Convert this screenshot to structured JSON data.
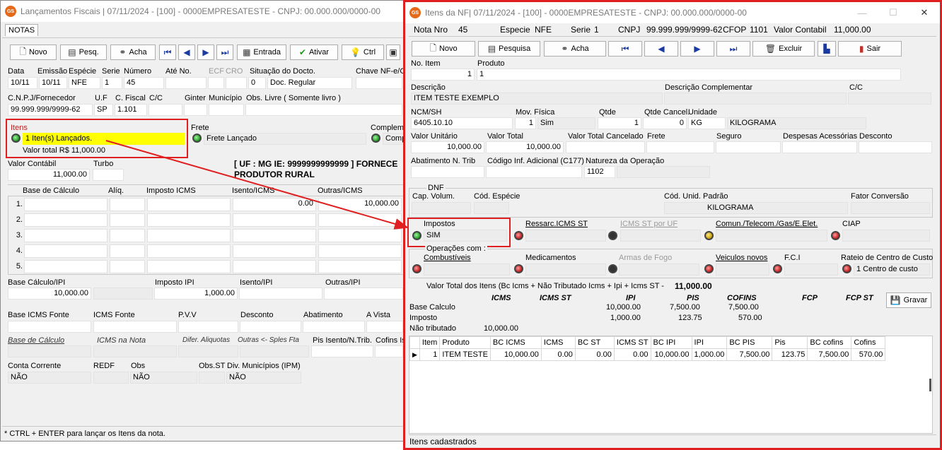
{
  "left": {
    "title": "Lançamentos Fiscais | 07/11/2024 - [100] - 0000EMPRESATESTE - CNPJ: 00.000.000/0000-00",
    "tab": "NOTAS",
    "toolbar": {
      "novo": "Novo",
      "pesq": "Pesq.",
      "acha": "Acha",
      "entrada": "Entrada",
      "ativar": "Ativar",
      "ctrl": "Ctrl"
    },
    "labels": {
      "data": "Data",
      "emissao": "Emissão",
      "especie": "Espécie",
      "serie": "Serie",
      "numero": "Número",
      "ate_no": "Até No.",
      "ecf": "ECF",
      "cro": "CRO",
      "situacao": "Situação do Docto.",
      "chave": "Chave NF-e/CT",
      "cnpj": "C.N.P.J/Fornecedor",
      "uf": "U.F",
      "cfiscal": "C. Fiscal",
      "cc": "C/C",
      "ginter": "Ginter",
      "municipio": "Município",
      "obs_livre": "Obs. Livre ( Somente livro )",
      "itens": "Itens",
      "frete": "Frete",
      "complem": "Complemen",
      "valor_contabil": "Valor Contábil",
      "turbo": "Turbo",
      "base_calc": "Base de Cálculo",
      "aliq": "Alíq.",
      "imposto_icms": "Imposto ICMS",
      "isento_icms": "Isento/ICMS",
      "outras_icms": "Outras/ICMS",
      "base_ipi": "Base Cálculo/IPI",
      "imposto_ipi": "Imposto IPI",
      "isento_ipi": "Isento/IPI",
      "outras_ipi": "Outras/IPI",
      "base_icms_fonte": "Base ICMS Fonte",
      "icms_fonte": "ICMS Fonte",
      "pvv": "P.V.V",
      "desconto": "Desconto",
      "abatimento": "Abatimento",
      "a_vista": "A Vista",
      "base_calc2": "Base de Cálculo",
      "icms_na_nota": "ICMS na Nota",
      "difer": "Difer. Aliquotas",
      "outras_sples": "Outras <- Sples Fta",
      "pis_isento": "Pis Isento/N.Trib.",
      "cofins_ise": "Cofins Ise",
      "conta_corrente": "Conta Corrente",
      "redf": "REDF",
      "obs": "Obs",
      "obs_st": "Obs.ST",
      "div_mun": "Div. Municípios (IPM)"
    },
    "values": {
      "data": "10/11",
      "emissao": "10/11",
      "especie": "NFE",
      "serie": "1",
      "numero": "45",
      "sit_code": "0",
      "sit_text": "Doc. Regular",
      "cnpj": "99.999.999/9999-62",
      "uf": "SP",
      "cfiscal": "1.101",
      "itens_status": "1 Iten(s) Lançados.",
      "itens_total": "Valor total R$ 11,000.00",
      "frete_status": "Frete Lançado",
      "complem_status": "Compl",
      "valor_contabil": "11,000.00",
      "uf_banner_line1": "[ UF : MG IE: 9999999999999 ] FORNECE",
      "uf_banner_line2": "PRODUTOR RURAL",
      "row1_isento": "0.00",
      "row1_outras": "10,000.00",
      "base_ipi": "10,000.00",
      "imposto_ipi": "1,000.00",
      "conta_corrente": "NÃO",
      "obs": "NÃO",
      "div_mun": "NÃO"
    },
    "rows": [
      "1.",
      "2.",
      "3.",
      "4.",
      "5."
    ],
    "status": "* CTRL + ENTER para  lançar os Itens da nota."
  },
  "right": {
    "title": "Itens da NF| 07/11/2024 - [100] - 0000EMPRESATESTE - CNPJ: 00.000.000/0000-00",
    "header": {
      "nota_nro_label": "Nota Nro",
      "nota_nro": "45",
      "especie_label": "Especie",
      "especie": "NFE",
      "serie_label": "Serie",
      "serie": "1",
      "cnpj_label": "CNPJ",
      "cnpj": "99.999.999/9999-62",
      "cfop_label": "CFOP",
      "cfop": "1101",
      "valor_label": "Valor Contabil",
      "valor": "11,000.00"
    },
    "toolbar": {
      "novo": "Novo",
      "pesquisa": "Pesquisa",
      "acha": "Acha",
      "excluir": "Excluir",
      "sair": "Sair"
    },
    "labels": {
      "no_item": "No. Item",
      "produto": "Produto",
      "descricao": "Descrição",
      "desc_comp": "Descrição Complementar",
      "cc": "C/C",
      "ncm": "NCM/SH",
      "mov_fisica": "Mov. Física",
      "qtde": "Qtde",
      "qtde_cancel": "Qtde Cancel.",
      "unidade": "Unidade",
      "valor_unit": "Valor Unitário",
      "valor_total": "Valor Total",
      "valor_total_cancel": "Valor Total Cancelado",
      "frete": "Frete",
      "seguro": "Seguro",
      "desp_acess": "Despesas Acessórias",
      "desconto": "Desconto",
      "abatimento": "Abatimento N. Trib",
      "cod_inf": "Código Inf. Adicional (C177)",
      "natureza": "Natureza da Operação",
      "dnf": "DNF",
      "cap_volum": "Cap. Volum.",
      "cod_especie": "Cód. Espécie",
      "cod_unid": "Cód. Unid. Padrão",
      "fator": "Fator Conversão",
      "impostos": "Impostos",
      "ressarc": "Ressarc.ICMS ST",
      "icms_st_uf": "ICMS ST por UF",
      "comun": "Comun./Telecom./Gas/E.Elet.",
      "ciap": "CIAP",
      "operacoes": "Operações com :",
      "combustiveis": "Combustíveis",
      "medicamentos": "Medicamentos",
      "armas": "Armas de Fogo",
      "veiculos": "Veiculos novos",
      "fci": "F.C.I",
      "rateio": "Rateio de Centro de Custo",
      "valor_total_itens": "Valor Total dos Itens (Bc Icms + Não Tributado Icms + Ipi + Icms ST -",
      "gravar": "Gravar"
    },
    "values": {
      "no_item": "1",
      "produto": "1",
      "descricao": "ITEM TESTE EXEMPLO",
      "ncm": "6405.10.10",
      "mov_fisica_code": "1",
      "mov_fisica": "Sim",
      "qtde": "1",
      "qtde_cancel": "0",
      "unid_code": "KG",
      "unid": "KILOGRAMA",
      "valor_unit": "10,000.00",
      "valor_total": "10,000.00",
      "natureza": "1102",
      "cod_unid": "KILOGRAMA",
      "impostos": "SIM",
      "rateio": "1 Centro de custo",
      "valor_total_itens": "11,000.00"
    },
    "summary": {
      "cols": [
        "ICMS",
        "ICMS ST",
        "IPI",
        "PIS",
        "COFINS",
        "FCP",
        "FCP ST"
      ],
      "rows": [
        {
          "label": "Base Calculo",
          "ipi": "10,000.00",
          "pis": "7,500.00",
          "cofins": "7,500.00"
        },
        {
          "label": "Imposto",
          "ipi": "1,000.00",
          "pis": "123.75",
          "cofins": "570.00"
        },
        {
          "label": "Não tributado",
          "icms": "10,000.00"
        }
      ]
    },
    "table": {
      "headers": [
        "Item",
        "Produto",
        "BC ICMS",
        "ICMS",
        "BC ST",
        "ICMS ST",
        "BC IPI",
        "IPI",
        "BC PIS",
        "Pis",
        "BC cofins",
        "Cofins"
      ],
      "rows": [
        [
          "1",
          "ITEM TESTE",
          "10,000.00",
          "0.00",
          "0.00",
          "0.00",
          "10,000.00",
          "1,000.00",
          "7,500.00",
          "123.75",
          "7,500.00",
          "570.00"
        ]
      ]
    },
    "status": "Itens cadastrados"
  }
}
